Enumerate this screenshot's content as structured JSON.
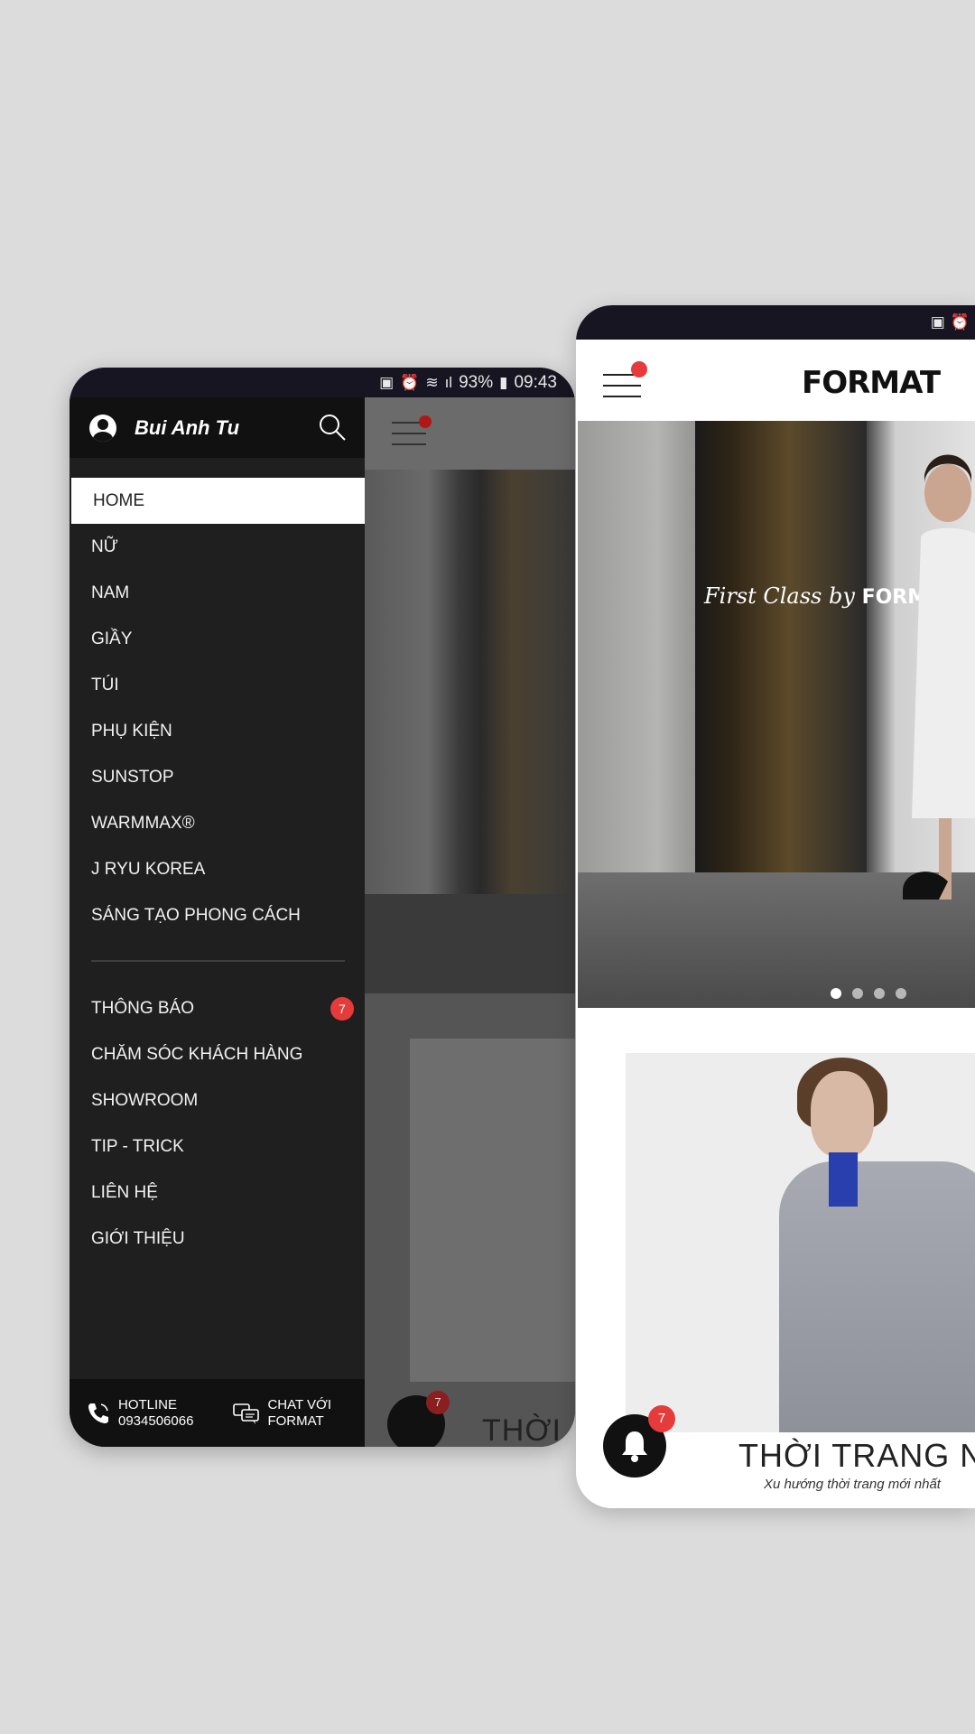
{
  "status_bar": {
    "battery": "93%",
    "time": "09:43"
  },
  "drawer": {
    "user_name": "Bui Anh Tu",
    "menu_primary": [
      {
        "label": "HOME",
        "active": true
      },
      {
        "label": "NỮ"
      },
      {
        "label": "NAM"
      },
      {
        "label": "GIẦY"
      },
      {
        "label": "TÚI"
      },
      {
        "label": "PHỤ KIỆN"
      },
      {
        "label": "SUNSTOP"
      },
      {
        "label": "WARMMAX®"
      },
      {
        "label": "J RYU KOREA"
      },
      {
        "label": "SÁNG TẠO PHONG CÁCH"
      }
    ],
    "menu_secondary": [
      {
        "label": "THÔNG BÁO",
        "badge": "7"
      },
      {
        "label": "CHĂM SÓC KHÁCH HÀNG"
      },
      {
        "label": "SHOWROOM"
      },
      {
        "label": "TIP - TRICK"
      },
      {
        "label": "LIÊN HỆ"
      },
      {
        "label": "GIỚI THIỆU"
      }
    ],
    "footer": {
      "hotline_label": "HOTLINE",
      "hotline_number": "0934506066",
      "chat_line1": "CHAT VỚI",
      "chat_line2": "FORMAT"
    }
  },
  "app": {
    "logo": "FORMAT",
    "hero_sign_script": "First Class",
    "hero_sign_by": "by",
    "hero_sign_brand": "FORMAT",
    "notification_count": "7",
    "product_title": "THỜI TRANG NỮ",
    "product_subtitle": "Xu hướng thời trang mới nhất",
    "overlay_title": "THỜI"
  },
  "colors": {
    "accent_red": "#e63b3b",
    "drawer_bg": "#1f1f1f",
    "status_bar": "#161521"
  },
  "icons": [
    "search-icon",
    "hamburger-icon",
    "bell-icon",
    "phone-icon",
    "chat-icon",
    "avatar-icon"
  ]
}
